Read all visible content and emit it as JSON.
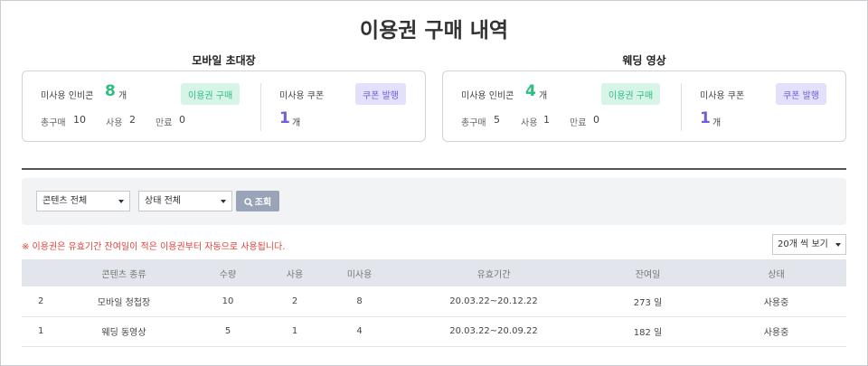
{
  "page_title": "이용권 구매 내역",
  "cards": [
    {
      "title": "모바일 초대장",
      "unused_label": "미사용 인비콘",
      "unused_count": "8",
      "unit": "개",
      "buy_label": "이용권 구매",
      "total_label": "총구매",
      "total_value": "10",
      "used_label": "사용",
      "used_value": "2",
      "expired_label": "만료",
      "expired_value": "0",
      "coupon_label": "미사용 쿠폰",
      "coupon_count": "1",
      "coupon_unit": "개",
      "coupon_btn": "쿠폰 발행"
    },
    {
      "title": "웨딩 영상",
      "unused_label": "미사용 인비콘",
      "unused_count": "4",
      "unit": "개",
      "buy_label": "이용권 구매",
      "total_label": "총구매",
      "total_value": "5",
      "used_label": "사용",
      "used_value": "1",
      "expired_label": "만료",
      "expired_value": "0",
      "coupon_label": "미사용 쿠폰",
      "coupon_count": "1",
      "coupon_unit": "개",
      "coupon_btn": "쿠폰 발행"
    }
  ],
  "filter": {
    "content_select": "콘텐츠 전체",
    "status_select": "상태 전체",
    "search_label": "조회"
  },
  "notice": "※ 이용권은 유효기간 잔여일이 적은 이용권부터 자동으로 사용됩니다.",
  "page_size": "20개 씩 보기",
  "table": {
    "headers": [
      "",
      "콘텐츠 종류",
      "수량",
      "사용",
      "미사용",
      "유효기간",
      "잔여일",
      "상태"
    ],
    "rows": [
      [
        "2",
        "모바일 청첩장",
        "10",
        "2",
        "8",
        "20.03.22~20.12.22",
        "273 일",
        "사용중"
      ],
      [
        "1",
        "웨딩 동영상",
        "5",
        "1",
        "4",
        "20.03.22~20.09.22",
        "182 일",
        "사용중"
      ]
    ]
  },
  "colors": {
    "accent_green": "#2ebd7f",
    "accent_purple": "#6f5fd8",
    "notice_red": "#e2433b"
  }
}
